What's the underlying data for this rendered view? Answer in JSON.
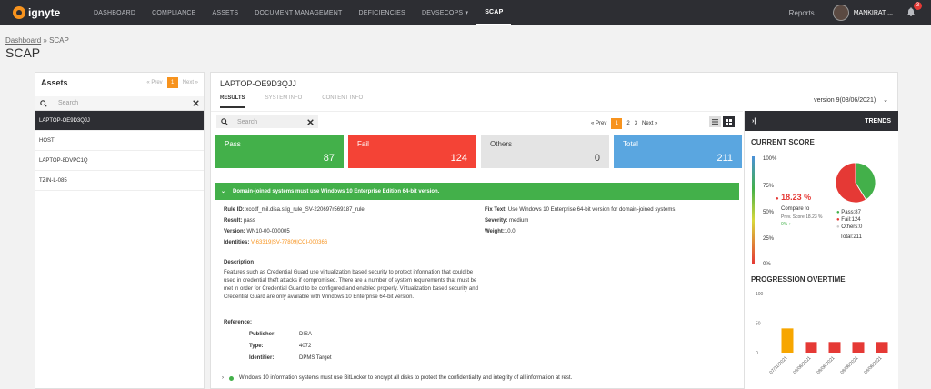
{
  "nav": {
    "brand": "ignyte",
    "items": [
      "DASHBOARD",
      "COMPLIANCE",
      "ASSETS",
      "DOCUMENT MANAGEMENT",
      "DEFICIENCIES",
      "DEVSECOPS",
      "SCAP"
    ],
    "devsecops_caret": "▾",
    "reports": "Reports",
    "user": "MANKIRAT ...",
    "notifications": "3"
  },
  "breadcrumb": {
    "root": "Dashboard",
    "sep": "»",
    "current": "SCAP"
  },
  "page_title": "SCAP",
  "assets": {
    "title": "Assets",
    "prev": "« Prev",
    "page": "1",
    "next": "Next »",
    "search_placeholder": "Search",
    "items": [
      "LAPTOP-OE9D3QJJ",
      "HOST",
      "LAPTOP-8DVPC1Q",
      "TZIN-L-085"
    ]
  },
  "main": {
    "device": "LAPTOP-OE9D3QJJ",
    "tabs": [
      "RESULTS",
      "SYSTEM INFO",
      "CONTENT INFO"
    ],
    "version": "version 9(08/06/2021)",
    "search_placeholder": "Search",
    "pager": {
      "prev": "« Prev",
      "pages": [
        "1",
        "2",
        "3"
      ],
      "next": "Next »"
    },
    "cards": [
      {
        "label": "Pass",
        "value": "87"
      },
      {
        "label": "Fail",
        "value": "124"
      },
      {
        "label": "Others",
        "value": "0"
      },
      {
        "label": "Total",
        "value": "211"
      }
    ],
    "rule_title": "Domain-joined systems must use Windows 10 Enterprise Edition 64-bit version.",
    "rule": {
      "rule_id_label": "Rule ID:",
      "rule_id": "xccdf_mil.disa.stig_rule_SV-220697r569187_rule",
      "result_label": "Result:",
      "result": "pass",
      "version_label": "Version:",
      "version": "WN10-00-000005",
      "identities_label": "Identities:",
      "identities": "V-63319|SV-77809|CCI-000366",
      "fix_label": "Fix Text:",
      "fix": "Use Windows 10 Enterprise 64-bit version for domain-joined systems.",
      "severity_label": "Severity:",
      "severity": "medium",
      "weight_label": "Weight:",
      "weight": "10.0"
    },
    "description_label": "Description",
    "description": "Features such as Credential Guard use virtualization based security to protect information that could be used in credential theft attacks if compromised. There are a number of system requirements that must be met in order for Credential Guard to be configured and enabled properly. Virtualization based security and Credential Guard are only available with Windows 10 Enterprise 64-bit version.",
    "reference_label": "Reference:",
    "reference": {
      "publisher_label": "Publisher:",
      "publisher": "DISA",
      "type_label": "Type:",
      "type": "4072",
      "identifier_label": "Identifier:",
      "identifier": "DPMS Target"
    },
    "next_rule": "Windows 10 information systems must use BitLocker to encrypt all disks to protect the confidentiality and integrity of all information at rest."
  },
  "trends": {
    "title": "TRENDS",
    "collapse_icon": "collapse-icon",
    "current_score_title": "CURRENT SCORE",
    "gauge_ticks": [
      "100%",
      "75%",
      "50%",
      "25%",
      "0%"
    ],
    "score": "18.23 %",
    "compare": "Compare to",
    "prev_score": "Prev. Score 18.23 %",
    "delta": "0% ↑",
    "legend": [
      {
        "label": "Pass:87",
        "color": "#43b04a"
      },
      {
        "label": "Fail:124",
        "color": "#e53935"
      },
      {
        "label": "Others:0",
        "color": "#dddddd"
      }
    ],
    "legend_total": "Total:211",
    "progression_title": "PROGRESSION OVERTIME"
  },
  "chart_data": {
    "type": "bar",
    "categories": [
      "07/31/2021",
      "08/06/2021",
      "08/06/2021",
      "08/06/2021",
      "08/06/2021"
    ],
    "values": [
      41,
      18,
      18,
      18,
      18
    ],
    "colors": [
      "#f7a600",
      "#e53935",
      "#e53935",
      "#e53935",
      "#e53935"
    ],
    "ylim": [
      0,
      100
    ],
    "yticks": [
      "100",
      "50",
      "0"
    ]
  },
  "pie_data": {
    "type": "pie",
    "values": [
      87,
      124,
      0
    ],
    "colors": [
      "#43b04a",
      "#e53935",
      "#dddddd"
    ]
  }
}
